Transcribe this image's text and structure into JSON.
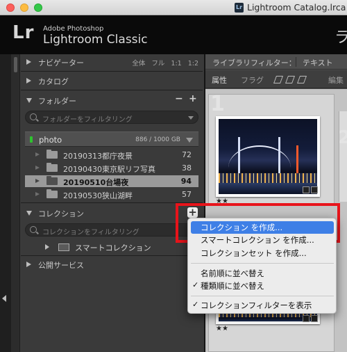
{
  "window": {
    "title": "Lightroom Catalog.lrca"
  },
  "identity": {
    "logo": "Lr",
    "brand_line1": "Adobe Photoshop",
    "brand_line2": "Lightroom Classic",
    "module_partial": "ラ"
  },
  "panels": {
    "navigator": {
      "label": "ナビゲーター",
      "options": "全体  フル  1:1  1:2"
    },
    "catalog": {
      "label": "カタログ"
    },
    "folders": {
      "label": "フォルダー",
      "filter_placeholder": "フォルダーをフィルタリング"
    },
    "collections": {
      "label": "コレクション",
      "filter_placeholder": "コレクションをフィルタリング"
    },
    "publish": {
      "label": "公開サービス"
    }
  },
  "volume": {
    "name": "photo",
    "capacity": "886 / 1000 GB"
  },
  "folders": [
    {
      "name": "20190313都庁夜景",
      "count": "72",
      "selected": false
    },
    {
      "name": "20190430東京駅リフ写真",
      "count": "38",
      "selected": false
    },
    {
      "name": "20190510台場夜",
      "count": "94",
      "selected": true
    },
    {
      "name": "20190530狭山湖畔",
      "count": "57",
      "selected": false
    }
  ],
  "smart_collection": {
    "label": "スマートコレクション"
  },
  "library_filter": {
    "label": "ライブラリフィルター：",
    "text": "テキスト"
  },
  "filter_bar": {
    "attributes": "属性",
    "flag": "フラグ",
    "edit": "編集"
  },
  "grid": {
    "cell1_number": "1",
    "cell2_number": "2",
    "stars": "★★"
  },
  "context_menu": {
    "items": [
      {
        "label": "コレクション を作成...",
        "highlighted": true,
        "checked": false
      },
      {
        "label": "スマートコレクション を作成...",
        "highlighted": false,
        "checked": false
      },
      {
        "label": "コレクションセット を作成...",
        "highlighted": false,
        "checked": false
      },
      {
        "label": "名前順に並べ替え",
        "highlighted": false,
        "checked": false
      },
      {
        "label": "種類順に並べ替え",
        "highlighted": false,
        "checked": true
      },
      {
        "label": "コレクションフィルターを表示",
        "highlighted": false,
        "checked": true
      }
    ]
  },
  "colors": {
    "highlight": "#3e7fe6",
    "annotation_box": "#e8141b",
    "volume_led": "#2fc32f"
  }
}
